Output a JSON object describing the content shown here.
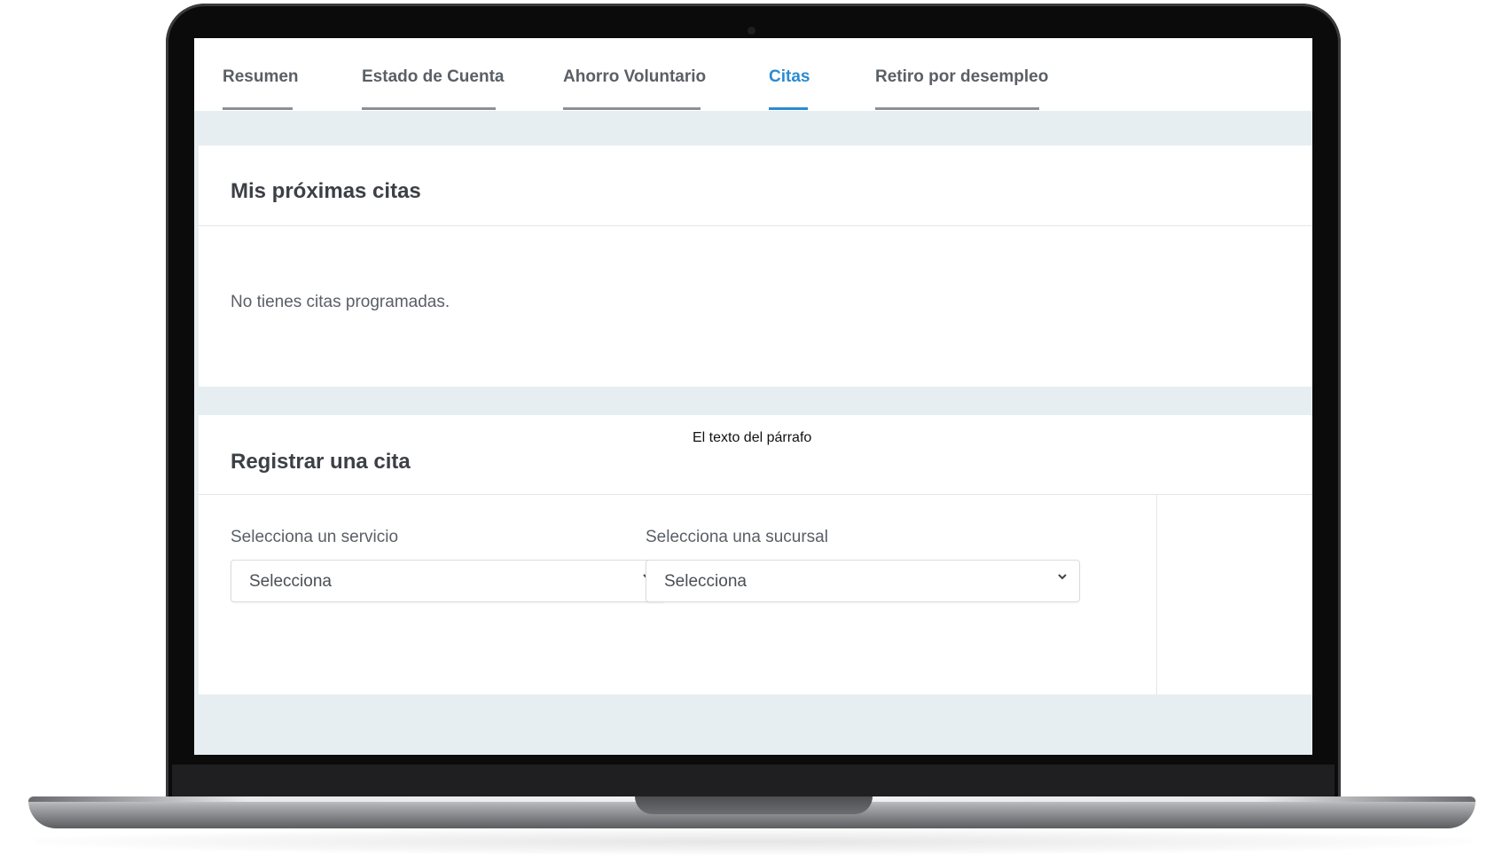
{
  "tabs": [
    {
      "label": "Resumen",
      "active": false
    },
    {
      "label": "Estado de Cuenta",
      "active": false
    },
    {
      "label": "Ahorro Voluntario",
      "active": false
    },
    {
      "label": "Citas",
      "active": true
    },
    {
      "label": "Retiro por desempleo",
      "active": false
    }
  ],
  "upcoming": {
    "title": "Mis próximas citas",
    "empty_message": "No tienes citas programadas."
  },
  "register": {
    "title": "Registrar una cita",
    "paragraph_placeholder": "El texto del párrafo",
    "service": {
      "label": "Selecciona un servicio",
      "value": "Selecciona"
    },
    "branch": {
      "label": "Selecciona una sucursal",
      "value": "Selecciona"
    }
  },
  "colors": {
    "accent": "#2a8bd1",
    "tab_text": "#5a5f66",
    "page_background": "#e7eef1"
  },
  "icons": {
    "select_arrow": "chevron-down-icon"
  }
}
